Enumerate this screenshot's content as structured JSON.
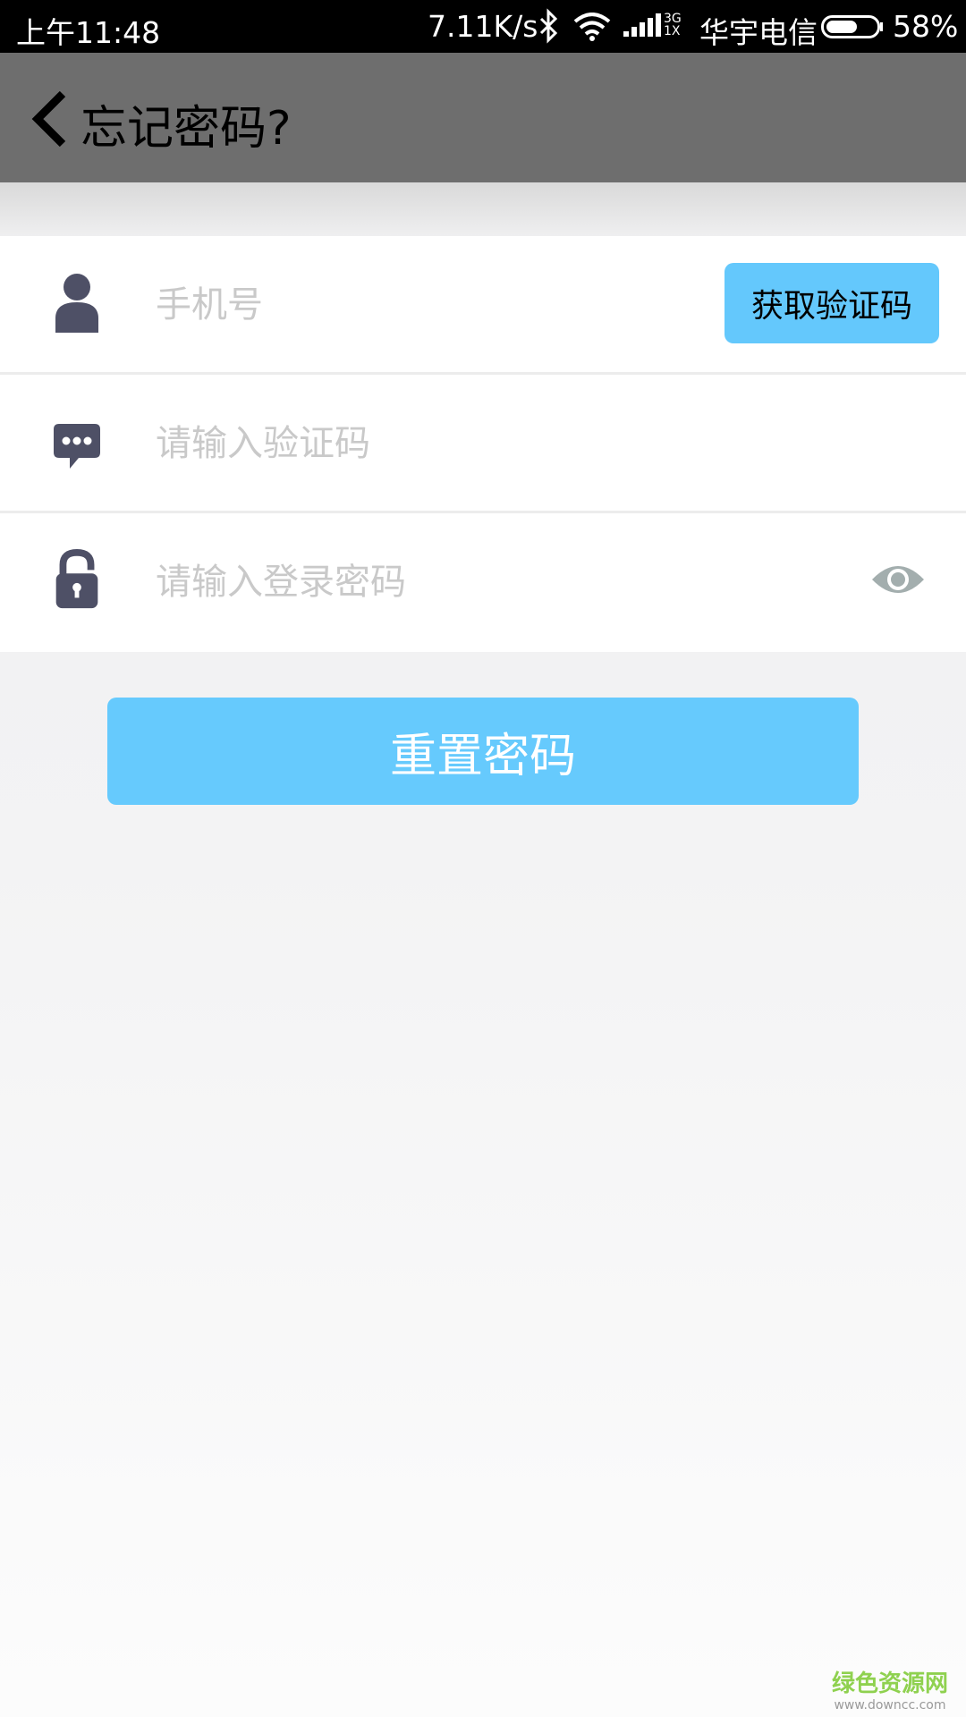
{
  "status_bar": {
    "time": "上午11:48",
    "net_speed": "7.11K/s",
    "network_type_top": "3G",
    "network_type_bottom": "1X",
    "carrier": "华宇电信",
    "battery_percent": "58%",
    "icons": [
      "bluetooth-icon",
      "wifi-icon",
      "signal-icon",
      "battery-icon"
    ]
  },
  "toolbar": {
    "title": "忘记密码?",
    "back_icon": "chevron-left-icon"
  },
  "form": {
    "phone": {
      "icon": "user-icon",
      "placeholder": "手机号",
      "value": "",
      "button_label": "获取验证码"
    },
    "code": {
      "icon": "chat-bubble-icon",
      "placeholder": "请输入验证码",
      "value": ""
    },
    "password": {
      "icon": "lock-icon",
      "placeholder": "请输入登录密码",
      "value": "",
      "toggle_icon": "eye-icon"
    }
  },
  "actions": {
    "reset_label": "重置密码"
  },
  "watermark": {
    "name": "绿色资源网",
    "url": "www.downcc.com"
  },
  "colors": {
    "accent": "#66cafd",
    "toolbar": "#6e6e6e",
    "icon": "#4e5066",
    "placeholder": "#c9c9c9"
  }
}
